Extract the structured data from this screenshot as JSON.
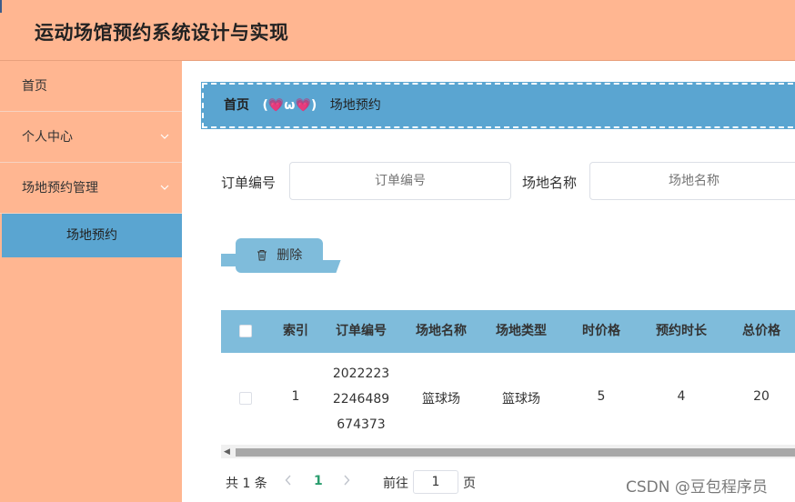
{
  "header": {
    "title": "运动场馆预约系统设计与实现"
  },
  "sidebar": {
    "items": [
      {
        "label": "首页",
        "has_chevron": false
      },
      {
        "label": "个人中心",
        "has_chevron": true
      },
      {
        "label": "场地预约管理",
        "has_chevron": true
      }
    ],
    "active_sub": "场地预约"
  },
  "breadcrumb": {
    "home": "首页",
    "separator": "(💗ω💗)",
    "current": "场地预约"
  },
  "search": {
    "order_label": "订单编号",
    "order_placeholder": "订单编号",
    "venue_label": "场地名称",
    "venue_placeholder": "场地名称"
  },
  "toolbar": {
    "delete_label": "删除",
    "delete_icon": "trash-icon"
  },
  "table": {
    "columns": [
      "索引",
      "订单编号",
      "场地名称",
      "场地类型",
      "时价格",
      "预约时长",
      "总价格"
    ],
    "rows": [
      {
        "index": "1",
        "order_no_lines": [
          "2022223",
          "2246489",
          "674373"
        ],
        "venue_name": "篮球场",
        "venue_type": "篮球场",
        "hourly_price": "5",
        "duration": "4",
        "total_price": "20"
      }
    ]
  },
  "pagination": {
    "total": "共 1 条",
    "prev_icon": "chevron-left-icon",
    "current_page": "1",
    "next_icon": "chevron-right-icon",
    "goto_label": "前往",
    "goto_value": "1",
    "page_unit": "页"
  },
  "watermark": "CSDN @豆包程序员",
  "colors": {
    "primary": "#ffb691",
    "accent": "#5aa5d1",
    "table_header": "#7fbcdb"
  }
}
